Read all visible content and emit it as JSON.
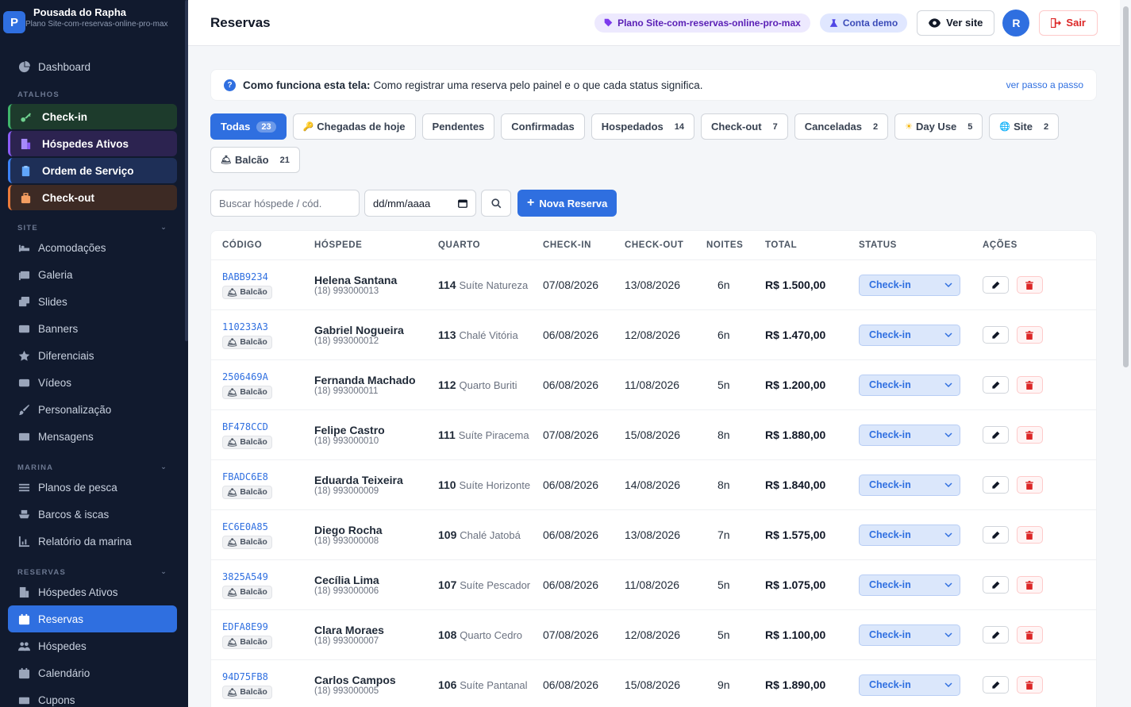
{
  "brand": {
    "name": "Pousada do Rapha",
    "plan": "Plano Site-com-reservas-online-pro-max",
    "logo_letter": "P"
  },
  "sidebar": {
    "dashboard": "Dashboard",
    "atalhos_label": "ATALHOS",
    "shortcuts": [
      {
        "label": "Check-in",
        "icon": "key-icon",
        "color": "#3fb56b"
      },
      {
        "label": "Hóspedes Ativos",
        "icon": "building-icon",
        "color": "#8b5cf6"
      },
      {
        "label": "Ordem de Serviço",
        "icon": "clipboard-icon",
        "color": "#3b82f6"
      },
      {
        "label": "Check-out",
        "icon": "luggage-icon",
        "color": "#ea7a3a"
      }
    ],
    "site_label": "SITE",
    "site_items": [
      "Acomodações",
      "Galeria",
      "Slides",
      "Banners",
      "Diferenciais",
      "Vídeos",
      "Personalização",
      "Mensagens"
    ],
    "marina_label": "MARINA",
    "marina_items": [
      "Planos de pesca",
      "Barcos & iscas",
      "Relatório da marina"
    ],
    "reservas_label": "RESERVAS",
    "reservas_items": [
      "Hóspedes Ativos",
      "Reservas",
      "Hóspedes",
      "Calendário",
      "Cupons"
    ]
  },
  "topbar": {
    "title": "Reservas",
    "plan_pill": "Plano Site-com-reservas-online-pro-max",
    "demo_pill": "Conta demo",
    "view_site": "Ver site",
    "avatar": "R",
    "exit": "Sair"
  },
  "info": {
    "strong": "Como funciona esta tela:",
    "text": "Como registrar uma reserva pelo painel e o que cada status significa.",
    "link": "ver passo a passo"
  },
  "filters": [
    {
      "label": "Todas",
      "count": "23",
      "active": true
    },
    {
      "label": "Chegadas de hoje",
      "count": "",
      "emoji": "🔑"
    },
    {
      "label": "Pendentes",
      "count": ""
    },
    {
      "label": "Confirmadas",
      "count": ""
    },
    {
      "label": "Hospedados",
      "count": "14"
    },
    {
      "label": "Check-out",
      "count": "7"
    },
    {
      "label": "Canceladas",
      "count": "2"
    },
    {
      "label": "Day Use",
      "count": "5",
      "emoji": "☀"
    },
    {
      "label": "Site",
      "count": "2",
      "emoji": "🌐"
    },
    {
      "label": "Balcão",
      "count": "21",
      "emoji": "🛎"
    }
  ],
  "search": {
    "placeholder": "Buscar hóspede / cód.",
    "date_placeholder": "dd/mm/aaaa",
    "new_button": "Nova Reserva"
  },
  "table": {
    "headers": [
      "CÓDIGO",
      "HÓSPEDE",
      "QUARTO",
      "CHECK-IN",
      "CHECK-OUT",
      "NOITES",
      "TOTAL",
      "STATUS",
      "AÇÕES"
    ],
    "rows": [
      {
        "code": "BABB9234",
        "source": "Balcão",
        "guest": "Helena Santana",
        "phone": "(18) 993000013",
        "room_num": "114",
        "room_name": "Suíte Natureza",
        "checkin": "07/08/2026",
        "checkout": "13/08/2026",
        "nights": "6n",
        "total": "R$ 1.500,00",
        "status": "Check-in"
      },
      {
        "code": "110233A3",
        "source": "Balcão",
        "guest": "Gabriel Nogueira",
        "phone": "(18) 993000012",
        "room_num": "113",
        "room_name": "Chalé Vitória",
        "checkin": "06/08/2026",
        "checkout": "12/08/2026",
        "nights": "6n",
        "total": "R$ 1.470,00",
        "status": "Check-in"
      },
      {
        "code": "2506469A",
        "source": "Balcão",
        "guest": "Fernanda Machado",
        "phone": "(18) 993000011",
        "room_num": "112",
        "room_name": "Quarto Buriti",
        "checkin": "06/08/2026",
        "checkout": "11/08/2026",
        "nights": "5n",
        "total": "R$ 1.200,00",
        "status": "Check-in"
      },
      {
        "code": "BF478CCD",
        "source": "Balcão",
        "guest": "Felipe Castro",
        "phone": "(18) 993000010",
        "room_num": "111",
        "room_name": "Suíte Piracema",
        "checkin": "07/08/2026",
        "checkout": "15/08/2026",
        "nights": "8n",
        "total": "R$ 1.880,00",
        "status": "Check-in"
      },
      {
        "code": "FBADC6E8",
        "source": "Balcão",
        "guest": "Eduarda Teixeira",
        "phone": "(18) 993000009",
        "room_num": "110",
        "room_name": "Suíte Horizonte",
        "checkin": "06/08/2026",
        "checkout": "14/08/2026",
        "nights": "8n",
        "total": "R$ 1.840,00",
        "status": "Check-in"
      },
      {
        "code": "EC6E0A85",
        "source": "Balcão",
        "guest": "Diego Rocha",
        "phone": "(18) 993000008",
        "room_num": "109",
        "room_name": "Chalé Jatobá",
        "checkin": "06/08/2026",
        "checkout": "13/08/2026",
        "nights": "7n",
        "total": "R$ 1.575,00",
        "status": "Check-in"
      },
      {
        "code": "3825A549",
        "source": "Balcão",
        "guest": "Cecília Lima",
        "phone": "(18) 993000006",
        "room_num": "107",
        "room_name": "Suíte Pescador",
        "checkin": "06/08/2026",
        "checkout": "11/08/2026",
        "nights": "5n",
        "total": "R$ 1.075,00",
        "status": "Check-in"
      },
      {
        "code": "EDFA8E99",
        "source": "Balcão",
        "guest": "Clara Moraes",
        "phone": "(18) 993000007",
        "room_num": "108",
        "room_name": "Quarto Cedro",
        "checkin": "07/08/2026",
        "checkout": "12/08/2026",
        "nights": "5n",
        "total": "R$ 1.100,00",
        "status": "Check-in"
      },
      {
        "code": "94D75FB8",
        "source": "Balcão",
        "guest": "Carlos Campos",
        "phone": "(18) 993000005",
        "room_num": "106",
        "room_name": "Suíte Pantanal",
        "checkin": "06/08/2026",
        "checkout": "15/08/2026",
        "nights": "9n",
        "total": "R$ 1.890,00",
        "status": "Check-in"
      }
    ]
  }
}
